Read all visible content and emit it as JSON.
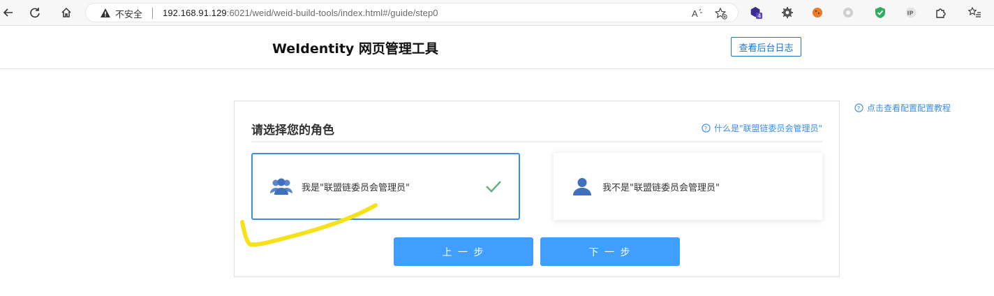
{
  "browser": {
    "security_label": "不安全",
    "url_host": "192.168.91.129",
    "url_path": ":6021/weid/weid-build-tools/index.html#/guide/step0",
    "read_aloud_icon": "read-aloud-icon",
    "favorite_icon": "add-favorite-icon",
    "extension_badge": "4"
  },
  "header": {
    "title": "WeIdentity 网页管理工具",
    "log_button": "查看后台日志"
  },
  "side_link": {
    "tutorial": "点击查看配置配置教程"
  },
  "panel": {
    "title": "请选择您的角色",
    "help_link": "什么是\"联盟链委员会管理员\"",
    "options": [
      {
        "label": "我是\"联盟链委员会管理员\"",
        "selected": true,
        "icon": "users-group-icon"
      },
      {
        "label": "我不是\"联盟链委员会管理员\"",
        "selected": false,
        "icon": "single-user-icon"
      }
    ],
    "prev_button": "上 一 步",
    "next_button": "下 一 步"
  },
  "colors": {
    "accent": "#409eff",
    "link": "#3a8ee6",
    "check": "#6ab187",
    "highlight_stroke": "#f5e21a"
  }
}
